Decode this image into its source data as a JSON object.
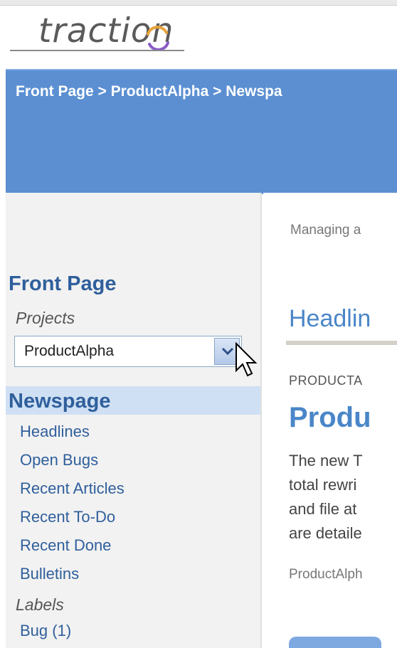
{
  "app": {
    "logo_text": "traction"
  },
  "header": {
    "breadcrumb": "Front Page > ProductAlpha > Newspa"
  },
  "sidebar": {
    "front_page": "Front Page",
    "projects_label": "Projects",
    "project_select_value": "ProductAlpha",
    "newspage": "Newspage",
    "items": [
      {
        "label": "Headlines"
      },
      {
        "label": "Open Bugs"
      },
      {
        "label": "Recent Articles"
      },
      {
        "label": "Recent To-Do"
      },
      {
        "label": "Recent Done"
      },
      {
        "label": "Bulletins"
      }
    ],
    "labels_label": "Labels",
    "label_items": [
      {
        "label": "Bug (1)"
      }
    ]
  },
  "main": {
    "managing_text": "Managing a",
    "section_title": "Headlin",
    "category": "PRODUCTA",
    "article_title": "Produ",
    "body_lines": [
      "The new T",
      "total rewri",
      "and file at",
      "are detaile"
    ],
    "byline": "ProductAlph"
  },
  "colors": {
    "accent_blue": "#5b8fd2",
    "link_blue": "#2f5f9c",
    "sidebar_bg": "#f2f2f2",
    "highlight_bg": "#cfe0f4"
  },
  "icons": {
    "select_arrow": "chevron-down-icon",
    "cursor": "mouse-pointer-icon",
    "logo_swoosh": "swoosh-icon"
  }
}
